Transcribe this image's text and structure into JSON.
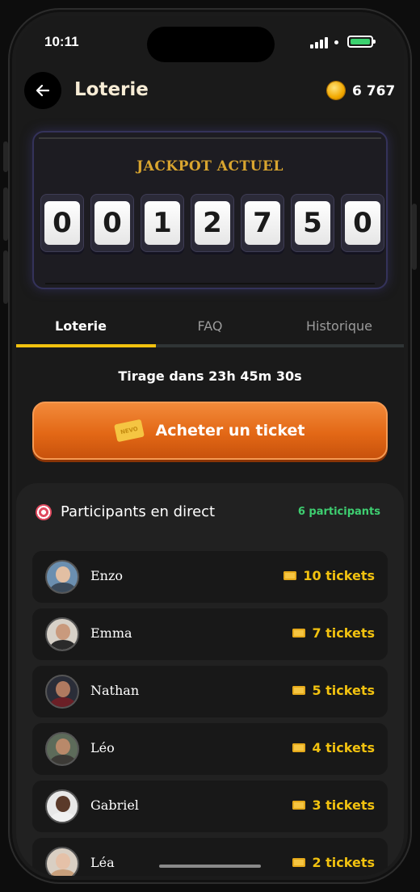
{
  "status_bar": {
    "time": "10:11"
  },
  "header": {
    "title": "Loterie",
    "coins": "6 767"
  },
  "jackpot": {
    "label": "JACKPOT ACTUEL",
    "digits": [
      "0",
      "0",
      "1",
      "2",
      "7",
      "5",
      "0"
    ]
  },
  "tabs": [
    {
      "label": "Loterie",
      "active": true
    },
    {
      "label": "FAQ",
      "active": false
    },
    {
      "label": "Historique",
      "active": false
    }
  ],
  "draw_countdown": "Tirage dans 23h 45m 30s",
  "buy_button": {
    "label": "Acheter un ticket",
    "ticket_text": "NEVO"
  },
  "participants": {
    "title": "Participants en direct",
    "count": "6 participants",
    "rows": [
      {
        "name": "Enzo",
        "tickets": "10 tickets"
      },
      {
        "name": "Emma",
        "tickets": "7 tickets"
      },
      {
        "name": "Nathan",
        "tickets": "5 tickets"
      },
      {
        "name": "Léo",
        "tickets": "4 tickets"
      },
      {
        "name": "Gabriel",
        "tickets": "3 tickets"
      },
      {
        "name": "Léa",
        "tickets": "2 tickets"
      }
    ]
  },
  "colors": {
    "accent_yellow": "#f2c20f",
    "button_orange": "#e36816",
    "participants_green": "#3ecf71",
    "jackpot_gold": "#d9a52f"
  }
}
